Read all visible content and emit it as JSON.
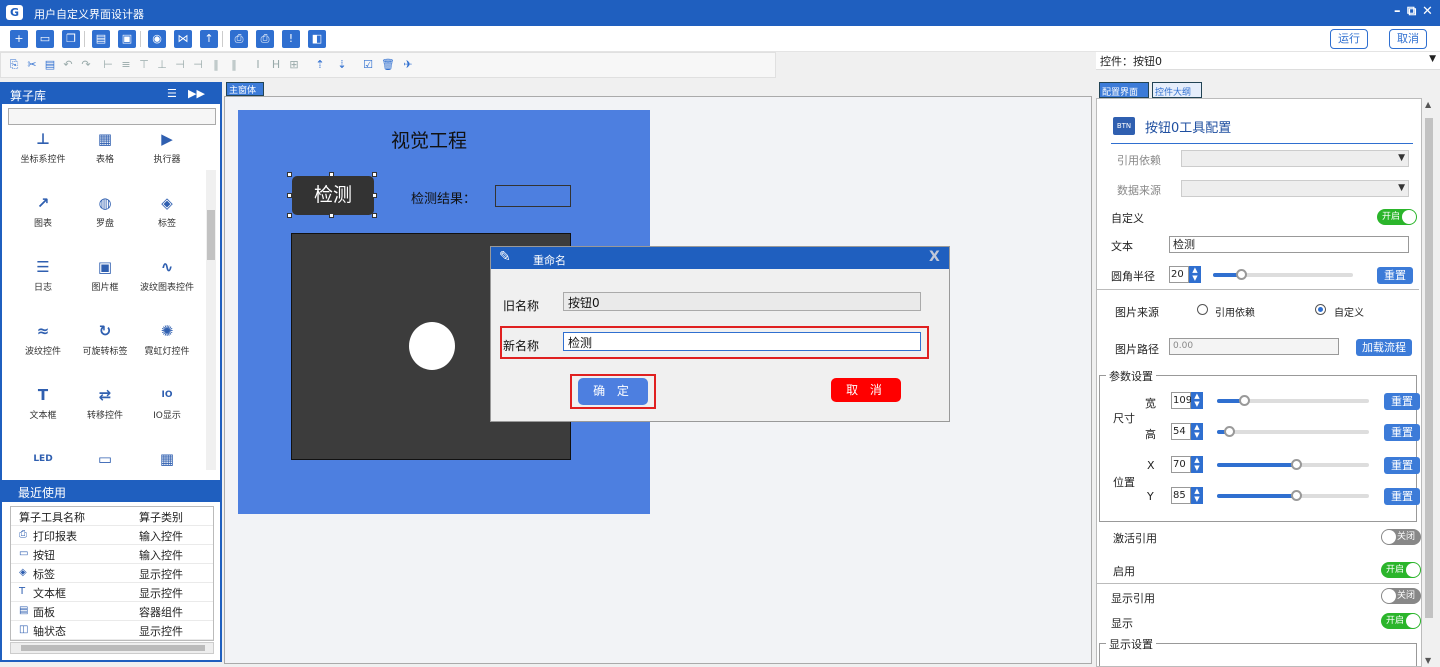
{
  "app": {
    "title": "用户自定义界面设计器"
  },
  "header": {
    "run": "运行",
    "cancel": "取消",
    "control_select": "控件：按钮0"
  },
  "left": {
    "title": "算子库",
    "operators": [
      {
        "label": "坐标系控件",
        "icon": "coordinate-icon",
        "glyph": "⊥"
      },
      {
        "label": "表格",
        "icon": "table-chart-icon",
        "glyph": "▦"
      },
      {
        "label": "执行器",
        "icon": "executor-icon",
        "glyph": "▶"
      },
      {
        "label": "图表",
        "icon": "chart-icon",
        "glyph": "↗"
      },
      {
        "label": "罗盘",
        "icon": "compass-icon",
        "glyph": "◍"
      },
      {
        "label": "标签",
        "icon": "tag-icon",
        "glyph": "◈"
      },
      {
        "label": "日志",
        "icon": "log-icon",
        "glyph": "☰"
      },
      {
        "label": "图片框",
        "icon": "image-icon",
        "glyph": "▣"
      },
      {
        "label": "波纹图表控件",
        "icon": "wave-chart-icon",
        "glyph": "∿"
      },
      {
        "label": "波纹控件",
        "icon": "wave-icon",
        "glyph": "≈"
      },
      {
        "label": "可旋转标签",
        "icon": "rotate-label-icon",
        "glyph": "↻"
      },
      {
        "label": "霓虹灯控件",
        "icon": "neon-icon",
        "glyph": "✺"
      },
      {
        "label": "文本框",
        "icon": "textbox-icon",
        "glyph": "T"
      },
      {
        "label": "转移控件",
        "icon": "transfer-icon",
        "glyph": "⇄"
      },
      {
        "label": "IO显示",
        "icon": "io-icon",
        "glyph": "IO"
      },
      {
        "label": "",
        "icon": "led-icon",
        "glyph": "LED"
      },
      {
        "label": "",
        "icon": "monitor-icon",
        "glyph": "▭"
      },
      {
        "label": "",
        "icon": "calendar-icon",
        "glyph": "▦"
      }
    ],
    "recent_title": "最近使用",
    "recent_headers": [
      "算子工具名称",
      "算子类别"
    ],
    "recent": [
      {
        "name": "打印报表",
        "cat": "输入控件",
        "icon": "print-icon",
        "glyph": "⎙"
      },
      {
        "name": "按钮",
        "cat": "输入控件",
        "icon": "button-icon",
        "glyph": "▭"
      },
      {
        "name": "标签",
        "cat": "显示控件",
        "icon": "tag-icon",
        "glyph": "◈"
      },
      {
        "name": "文本框",
        "cat": "显示控件",
        "icon": "textbox-icon",
        "glyph": "T"
      },
      {
        "name": "面板",
        "cat": "容器组件",
        "icon": "panel-icon",
        "glyph": "▤"
      },
      {
        "name": "轴状态",
        "cat": "显示控件",
        "icon": "axis-icon",
        "glyph": "◫"
      }
    ]
  },
  "canvas": {
    "tab": "主窗体",
    "form_title": "视觉工程",
    "detect_button": "检测",
    "result_label": "检测结果："
  },
  "dialog": {
    "title": "重命名",
    "old_label": "旧名称",
    "old_value": "按钮0",
    "new_label": "新名称",
    "new_value": "检测",
    "ok": "确 定",
    "cancel": "取 消",
    "close": "X"
  },
  "right": {
    "tabs": [
      "配置界面",
      "控件大纲"
    ],
    "heading": "按钮0工具配置",
    "ref_dep": "引用依赖",
    "data_src": "数据来源",
    "custom": "自定义",
    "on": "开启",
    "off": "关闭",
    "text_label": "文本",
    "text_value": "检测",
    "radius_label": "圆角半径",
    "radius_value": "20",
    "reset": "重置",
    "img_src": "图片来源",
    "img_ref": "引用依赖",
    "img_custom": "自定义",
    "img_path": "图片路径",
    "img_path_value": "0.00",
    "load_flow": "加载流程",
    "params": "参数设置",
    "size": "尺寸",
    "w": "宽",
    "h": "高",
    "pos": "位置",
    "x": "X",
    "y": "Y",
    "w_val": "109",
    "h_val": "54",
    "x_val": "70",
    "y_val": "85",
    "activate_ref": "激活引用",
    "enable": "启用",
    "display_ref": "显示引用",
    "display": "显示",
    "display_settings": "显示设置"
  }
}
